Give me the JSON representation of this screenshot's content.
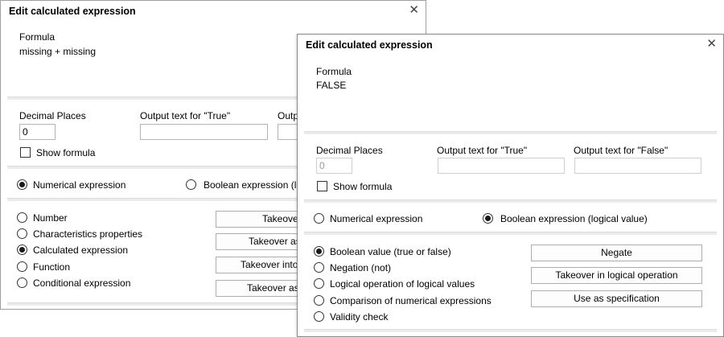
{
  "dialog_back": {
    "title": "Edit calculated expression",
    "formula_label": "Formula",
    "formula_value": "missing + missing",
    "decimal_places_label": "Decimal Places",
    "decimal_places_value": "0",
    "output_true_label": "Output text for \"True\"",
    "output_false_label": "Outpu",
    "show_formula_label": "Show formula",
    "numerical_label": "Numerical expression",
    "boolean_label": "Boolean expression (logic",
    "selected_type": "numerical",
    "options": [
      {
        "label": "Number",
        "selected": false
      },
      {
        "label": "Characteristics properties",
        "selected": false
      },
      {
        "label": "Calculated expression",
        "selected": true
      },
      {
        "label": "Function",
        "selected": false
      },
      {
        "label": "Conditional expression",
        "selected": false
      }
    ],
    "buttons": [
      "Takeover",
      "Takeover as",
      "Takeover into c",
      "Takeover as c"
    ]
  },
  "dialog_front": {
    "title": "Edit calculated expression",
    "formula_label": "Formula",
    "formula_value": "FALSE",
    "decimal_places_label": "Decimal Places",
    "decimal_places_value": "0",
    "output_true_label": "Output text for \"True\"",
    "output_false_label": "Output text for \"False\"",
    "show_formula_label": "Show formula",
    "numerical_label": "Numerical expression",
    "boolean_label": "Boolean expression (logical value)",
    "selected_type": "boolean",
    "options": [
      {
        "label": "Boolean value (true or false)",
        "selected": true
      },
      {
        "label": "Negation (not)",
        "selected": false
      },
      {
        "label": "Logical operation of logical values",
        "selected": false
      },
      {
        "label": "Comparison of numerical expressions",
        "selected": false
      },
      {
        "label": "Validity check",
        "selected": false
      }
    ],
    "buttons": [
      "Negate",
      "Takeover in logical operation",
      "Use as specification"
    ]
  }
}
